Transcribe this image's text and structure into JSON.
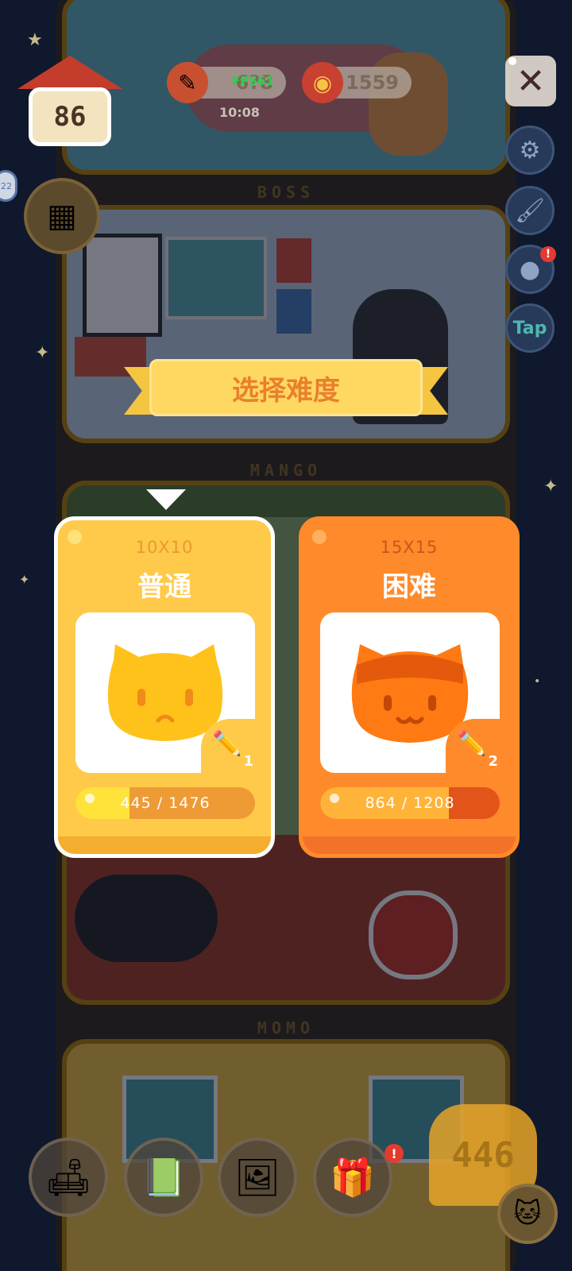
{
  "hud": {
    "level": "86",
    "coins": "6?8",
    "fps": "FPS61",
    "timer": "10:08",
    "cans": "1559",
    "close_glyph": "✕",
    "left_badge": "22"
  },
  "floors": {
    "boss_label": "BOSS",
    "mango_label": "MANGO",
    "momo_label": "MOMO"
  },
  "side": {
    "tap_label": "Tap",
    "badge": "!"
  },
  "dialog": {
    "title": "选择难度",
    "cards": [
      {
        "size": "10X10",
        "name": "普通",
        "pencil_count": "1",
        "progress_text": "445 / 1476",
        "progress_value": 445,
        "progress_max": 1476,
        "selected": true
      },
      {
        "size": "15X15",
        "name": "困难",
        "pencil_count": "2",
        "progress_text": "864 / 1208",
        "progress_value": 864,
        "progress_max": 1208,
        "selected": false
      }
    ]
  },
  "bottom": {
    "counter": "446",
    "badge": "!"
  },
  "icons": {
    "pencil": "pencil-icon",
    "gear": "gear-icon",
    "close": "close-icon",
    "cat": "cat-icon"
  },
  "colors": {
    "normal_card": "#ffc94a",
    "hard_card": "#ff8a2b",
    "title_text": "#e9802e",
    "banner": "#ffd861"
  }
}
